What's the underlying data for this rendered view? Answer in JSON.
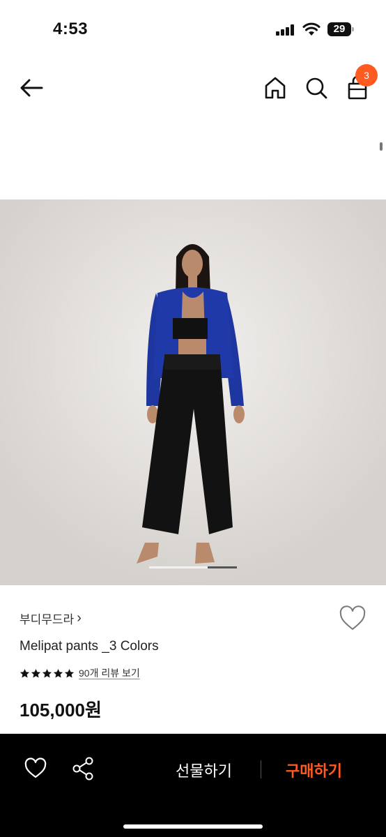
{
  "status_bar": {
    "time": "4:53",
    "battery": "29"
  },
  "nav": {
    "cart_count": "3",
    "icons": [
      "back-arrow-icon",
      "home-icon",
      "search-icon",
      "shopping-bag-icon"
    ]
  },
  "product": {
    "brand": "부디무드라",
    "brand_chevron": "›",
    "name": "Melipat pants _3 Colors",
    "rating_stars": 5,
    "review_text": "90개 리뷰 보기",
    "price": "105,000원",
    "image_slide": 3,
    "image_slides_total": 3
  },
  "bottom_bar": {
    "gift_label": "선물하기",
    "buy_label": "구매하기",
    "icons": [
      "heart-icon",
      "share-icon"
    ]
  },
  "colors": {
    "accent": "#ff5a1f",
    "bottom_bar_bg": "#000000",
    "image_bg": "#d7d3cf"
  }
}
